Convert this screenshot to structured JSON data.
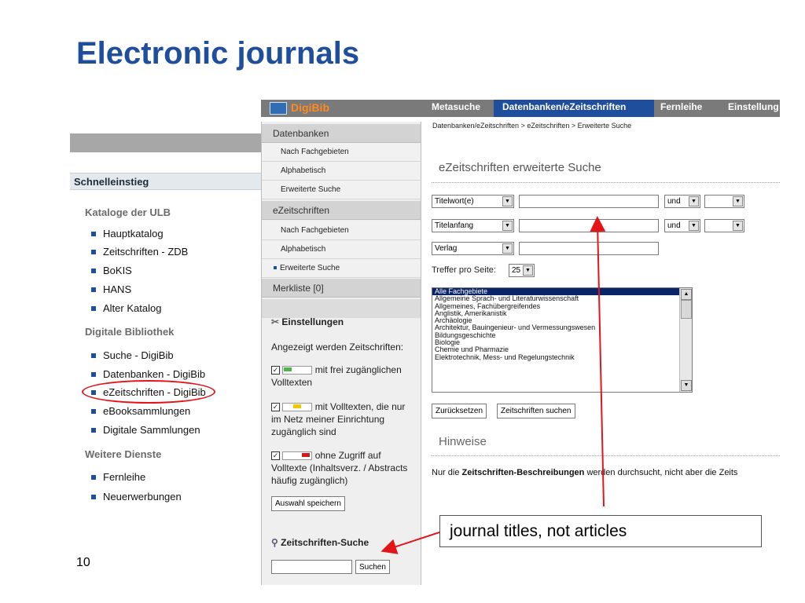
{
  "slide": {
    "title": "Electronic journals",
    "page_number": "10",
    "callout": "journal titles, not articles"
  },
  "ulb": {
    "heading": "Schnelleinstieg",
    "categories": [
      {
        "label": "Kataloge der ULB",
        "items": [
          "Hauptkatalog",
          "Zeitschriften - ZDB",
          "BoKIS",
          "HANS",
          "Alter Katalog"
        ]
      },
      {
        "label": "Digitale Bibliothek",
        "items": [
          "Suche - DigiBib",
          "Datenbanken - DigiBib",
          "eZeitschriften - DigiBib",
          "eBooksammlungen",
          "Digitale Sammlungen"
        ]
      },
      {
        "label": "Weitere Dienste",
        "items": [
          "Fernleihe",
          "Neuerwerbungen"
        ]
      }
    ]
  },
  "digibib": {
    "logo": "DigiBib",
    "tabs": [
      "Metasuche",
      "Datenbanken/eZeitschriften",
      "Fernleihe",
      "Einstellung"
    ],
    "breadcrumb": "Datenbanken/eZeitschriften > eZeitschriften > Erweiterte Suche",
    "sidebar": {
      "sec1": "Datenbanken",
      "sec1_items": [
        "Nach Fachgebieten",
        "Alphabetisch",
        "Erweiterte Suche"
      ],
      "sec2": "eZeitschriften",
      "sec2_items": [
        "Nach Fachgebieten",
        "Alphabetisch",
        "Erweiterte Suche"
      ],
      "merkliste": "Merkliste [0]",
      "settings_title": "Einstellungen",
      "settings_intro": "Angezeigt werden Zeitschriften:",
      "opt1": "mit frei zugänglichen Volltexten",
      "opt2": "mit Volltexten, die nur im Netz meiner Einrichtung zugänglich sind",
      "opt3": "ohne Zugriff auf Volltexte (Inhaltsverz. / Abstracts häufig zugänglich)",
      "save_btn": "Auswahl speichern",
      "search_title": "Zeitschriften-Suche",
      "search_btn": "Suchen"
    },
    "form": {
      "title": "eZeitschriften erweiterte Suche",
      "row1_field": "Titelwort(e)",
      "row2_field": "Titelanfang",
      "row3_field": "Verlag",
      "op1": "und",
      "op2": "und",
      "per_page_label": "Treffer pro Seite:",
      "per_page_value": "25",
      "subjects": [
        "Alle Fachgebiete",
        "Allgemeine Sprach- und Literaturwissenschaft",
        "Allgemeines, Fachübergreifendes",
        "Anglistik, Amerikanistik",
        "Archäologie",
        "Architektur, Bauingenieur- und Vermessungswesen",
        "Bildungsgeschichte",
        "Biologie",
        "Chemie und Pharmazie",
        "Elektrotechnik, Mess- und Regelungstechnik"
      ],
      "reset_btn": "Zurücksetzen",
      "search_btn": "Zeitschriften suchen",
      "hinweise_title": "Hinweise",
      "hinweise_pre": "Nur die ",
      "hinweise_bold": "Zeitschriften-Beschreibungen",
      "hinweise_post": " werden durchsucht, nicht aber die Zeits"
    }
  },
  "colors": {
    "title_blue": "#1f4e9c",
    "annotation_red": "#e3151a",
    "digibib_bar": "#7a7a7a",
    "active_tab": "#1f4e9c"
  }
}
